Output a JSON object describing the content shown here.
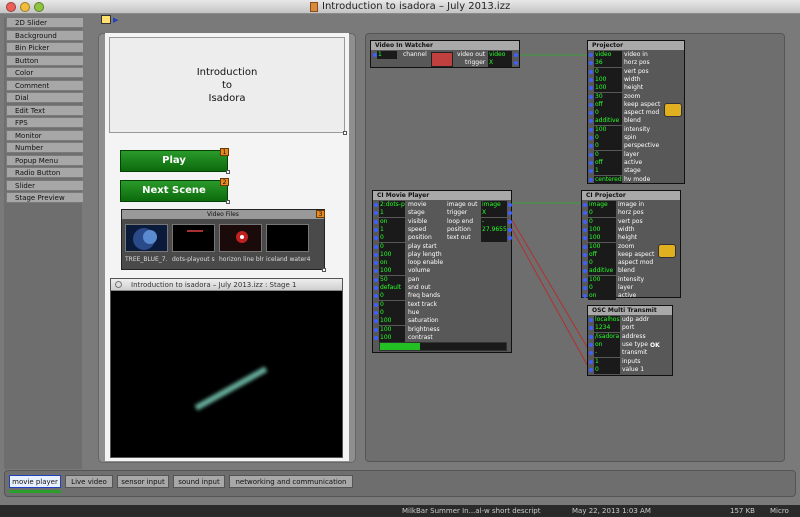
{
  "window": {
    "title": "Introduction to isadora – July 2013.izz"
  },
  "controls_list": [
    "2D Slider",
    "Background",
    "Bin Picker",
    "Button",
    "Color",
    "Comment",
    "Dial",
    "Edit Text",
    "FPS",
    "Monitor",
    "Number",
    "Popup Menu",
    "Radio Button",
    "Slider",
    "Stage Preview"
  ],
  "control_panel": {
    "intro_text": "Introduction\nto\nIsadora",
    "play_label": "Play",
    "play_badge": "1",
    "next_label": "Next Scene",
    "next_badge": "2",
    "video_files": {
      "title": "Video Files",
      "badge": "3",
      "items": [
        "TREE_BLUE_7.",
        "dots-playout s",
        "horizon line blr",
        "iceland water4"
      ]
    }
  },
  "stage": {
    "title": "Introduction to isadora – July 2013.izz : Stage 1"
  },
  "actors": {
    "video_in": {
      "title": "Video In Watcher",
      "channel_val": "1",
      "channel_label": "channel",
      "out1_label": "video out",
      "out1_val": "video",
      "out2_label": "trigger",
      "out2_val": "X"
    },
    "projector": {
      "title": "Projector",
      "rows": [
        {
          "v": "video",
          "l": "video in"
        },
        {
          "v": "36",
          "l": "horz pos"
        },
        {
          "v": "0",
          "l": "vert pos"
        },
        {
          "v": "100",
          "l": "width"
        },
        {
          "v": "100",
          "l": "height"
        },
        {
          "v": "30",
          "l": "zoom"
        },
        {
          "v": "off",
          "l": "keep aspect"
        },
        {
          "v": "0",
          "l": "aspect mod"
        },
        {
          "v": "additive",
          "l": "blend"
        },
        {
          "v": "100",
          "l": "intensity"
        },
        {
          "v": "0",
          "l": "spin"
        },
        {
          "v": "0",
          "l": "perspective"
        },
        {
          "v": "0",
          "l": "layer"
        },
        {
          "v": "off",
          "l": "active"
        },
        {
          "v": "1",
          "l": "stage"
        },
        {
          "v": "centered",
          "l": "hv mode"
        }
      ]
    },
    "movie_player": {
      "title": "CI Movie Player",
      "inputs": [
        {
          "v": "2:dots-p",
          "l": "movie"
        },
        {
          "v": "1",
          "l": "stage"
        },
        {
          "v": "on",
          "l": "visible"
        },
        {
          "v": "1",
          "l": "speed"
        },
        {
          "v": "0",
          "l": "position"
        },
        {
          "v": "0",
          "l": "play start"
        },
        {
          "v": "100",
          "l": "play length"
        },
        {
          "v": "on",
          "l": "loop enable"
        },
        {
          "v": "100",
          "l": "volume"
        },
        {
          "v": "50",
          "l": "pan"
        },
        {
          "v": "default",
          "l": "snd out"
        },
        {
          "v": "0",
          "l": "freq bands"
        },
        {
          "v": "0",
          "l": "text track"
        },
        {
          "v": "0",
          "l": "hue"
        },
        {
          "v": "100",
          "l": "saturation"
        },
        {
          "v": "100",
          "l": "brightness"
        },
        {
          "v": "100",
          "l": "contrast"
        }
      ],
      "outputs": [
        {
          "l": "image out",
          "v": "image"
        },
        {
          "l": "trigger",
          "v": "X"
        },
        {
          "l": "loop end",
          "v": "-"
        },
        {
          "l": "position",
          "v": "27.9655"
        },
        {
          "l": "text out",
          "v": ""
        }
      ],
      "progress": 0.32
    },
    "ci_projector": {
      "title": "CI Projector",
      "rows": [
        {
          "v": "image",
          "l": "image in"
        },
        {
          "v": "0",
          "l": "horz pos"
        },
        {
          "v": "0",
          "l": "vert pos"
        },
        {
          "v": "100",
          "l": "width"
        },
        {
          "v": "100",
          "l": "height"
        },
        {
          "v": "100",
          "l": "zoom"
        },
        {
          "v": "off",
          "l": "keep aspect"
        },
        {
          "v": "0",
          "l": "aspect mod"
        },
        {
          "v": "additive",
          "l": "blend"
        },
        {
          "v": "100",
          "l": "intensity"
        },
        {
          "v": "0",
          "l": "layer"
        },
        {
          "v": "on",
          "l": "active"
        }
      ]
    },
    "osc": {
      "title": "OSC Multi Transmit",
      "rows": [
        {
          "v": "localhost",
          "l": "udp addr"
        },
        {
          "v": "1234",
          "l": "port"
        },
        {
          "v": "/isadora",
          "l": "address"
        },
        {
          "v": "on",
          "l": "use type"
        },
        {
          "v": "-",
          "l": "transmit"
        },
        {
          "v": "1",
          "l": "inputs"
        },
        {
          "v": "0",
          "l": "value 1"
        }
      ],
      "osc_badge": "OK"
    }
  },
  "tabs": [
    "movie player",
    "Live video",
    "sensor input",
    "sound input",
    "networking and communication"
  ],
  "dock": {
    "item1": "MilkBar Summer In...al-w short descript",
    "item2": "May 22, 2013 1:03 AM",
    "item3": "157 KB",
    "item4": "Micro"
  }
}
